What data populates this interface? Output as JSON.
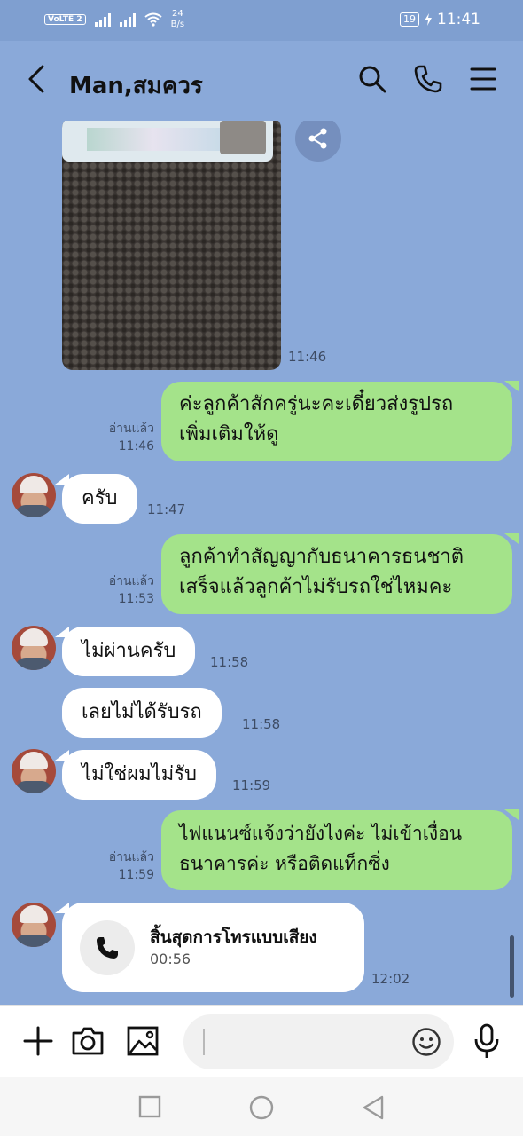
{
  "status_bar": {
    "volte": "VoLTE",
    "sim": "2",
    "net_speed_value": "24",
    "net_speed_unit": "B/s",
    "battery": "19",
    "time": "11:41"
  },
  "header": {
    "title": "Man,สมควร",
    "icons": [
      "back-arrow-icon",
      "search-icon",
      "phone-icon",
      "menu-icon"
    ]
  },
  "messages": {
    "photo_time": "11:46",
    "m1": {
      "line1": "ค่ะลูกค้าสักครู่นะคะเดี๋ยวส่งรูปรถ",
      "line2": "เพิ่มเติมให้ดู",
      "read": "อ่านแล้ว",
      "time": "11:46"
    },
    "m2": {
      "text": "ครับ",
      "time": "11:47"
    },
    "m3": {
      "line1": "ลูกค้าทำสัญญากับธนาคารธนชาติ",
      "line2": "เสร็จแล้วลูกค้าไม่รับรถใช่ไหมคะ",
      "read": "อ่านแล้ว",
      "time": "11:53"
    },
    "m4": {
      "text": "ไม่ผ่านครับ",
      "time": "11:58"
    },
    "m5": {
      "text": "เลยไม่ได้รับรถ",
      "time": "11:58"
    },
    "m6": {
      "text": "ไม่ใช่ผมไม่รับ",
      "time": "11:59"
    },
    "m7": {
      "line1": "ไฟแนนซ์แจ้งว่ายังไงค่ะ ไม่เข้าเงื่อน",
      "line2": "ธนาคารค่ะ หรือติดแท็กซิ่ง",
      "read": "อ่านแล้ว",
      "time": "11:59"
    },
    "call": {
      "title": "สิ้นสุดการโทรแบบเสียง",
      "duration": "00:56",
      "time": "12:02"
    }
  },
  "input_bar": {
    "icons": [
      "plus-icon",
      "camera-icon",
      "image-icon",
      "emoji-icon",
      "microphone-icon"
    ],
    "value": ""
  },
  "nav_bar": {
    "icons": [
      "recent-apps-icon",
      "home-icon",
      "back-triangle-icon"
    ]
  },
  "colors": {
    "chat_bg": "#8aa9d9",
    "outgoing_bubble": "#a4e38a",
    "incoming_bubble": "#ffffff"
  }
}
